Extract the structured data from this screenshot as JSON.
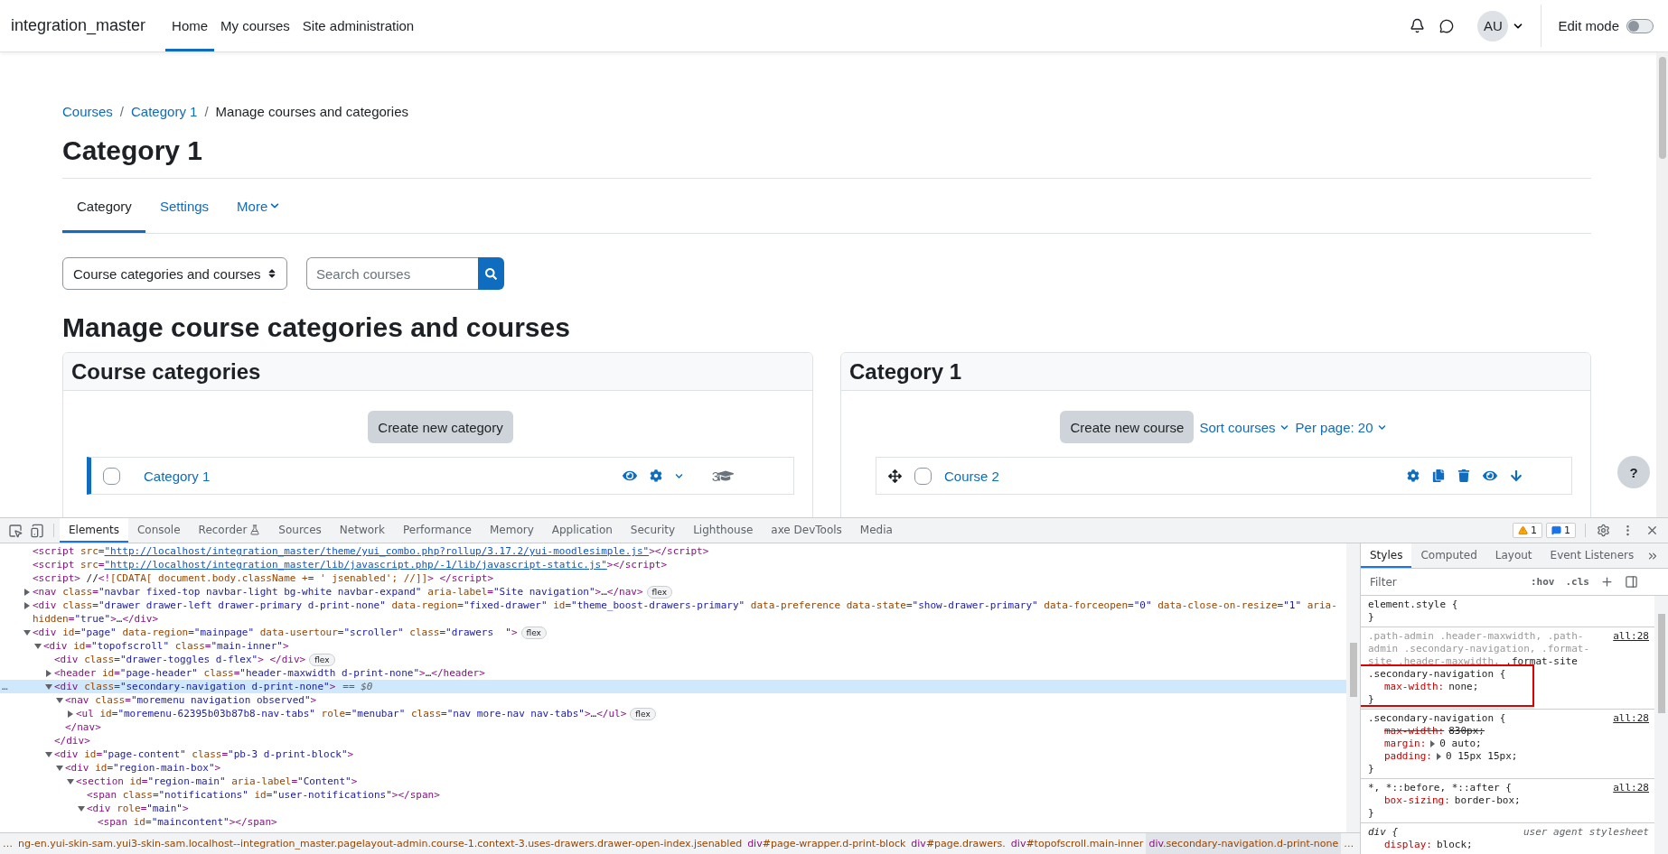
{
  "navbar": {
    "brand": "integration_master",
    "links": [
      {
        "label": "Home",
        "selected": true
      },
      {
        "label": "My courses",
        "selected": false
      },
      {
        "label": "Site administration",
        "selected": false
      }
    ],
    "avatar": "AU",
    "edit_mode": {
      "label": "Edit mode",
      "on": false
    }
  },
  "breadcrumb": [
    {
      "kind": "link",
      "text": "Courses"
    },
    {
      "kind": "separator",
      "text": "/"
    },
    {
      "kind": "link",
      "text": "Category 1"
    },
    {
      "kind": "separator",
      "text": "/"
    },
    {
      "kind": "current",
      "text": "Manage courses and categories"
    }
  ],
  "page_title": "Category 1",
  "tabs": [
    {
      "label": "Category",
      "selected": true,
      "dropdown": false
    },
    {
      "label": "Settings",
      "selected": false,
      "dropdown": false
    },
    {
      "label": "More",
      "selected": false,
      "dropdown": true
    }
  ],
  "view_select": {
    "value": "Course categories and courses"
  },
  "search": {
    "placeholder": "Search courses"
  },
  "heading": "Manage course categories and courses",
  "categories_panel": {
    "title": "Course categories",
    "create_button": "Create new category",
    "rows": [
      {
        "name": "Category 1",
        "checked": false,
        "selected": true,
        "visible": true,
        "count": "3"
      }
    ]
  },
  "courses_panel": {
    "title": "Category 1",
    "create_button": "Create new course",
    "sort": "Sort courses",
    "per_page": "Per page: 20",
    "rows": [
      {
        "name": "Course 2",
        "checked": false,
        "visible": true
      }
    ]
  },
  "help_button": "?",
  "devtools": {
    "tabs": [
      {
        "label": "Elements",
        "selected": true,
        "experimental": false
      },
      {
        "label": "Console",
        "selected": false,
        "experimental": false
      },
      {
        "label": "Recorder",
        "selected": false,
        "experimental": true
      },
      {
        "label": "Sources",
        "selected": false,
        "experimental": false
      },
      {
        "label": "Network",
        "selected": false,
        "experimental": false
      },
      {
        "label": "Performance",
        "selected": false,
        "experimental": false
      },
      {
        "label": "Memory",
        "selected": false,
        "experimental": false
      },
      {
        "label": "Application",
        "selected": false,
        "experimental": false
      },
      {
        "label": "Security",
        "selected": false,
        "experimental": false
      },
      {
        "label": "Lighthouse",
        "selected": false,
        "experimental": false
      },
      {
        "label": "axe DevTools",
        "selected": false,
        "experimental": false
      },
      {
        "label": "Media",
        "selected": false,
        "experimental": false
      }
    ],
    "warnings": "1",
    "messages": "1",
    "tree": [
      {
        "markup": "<script src=\"http://localhost/integration_master/theme/yui_combo.php?rollup/3.17.2/yui-moodlesimple.js\"></script>",
        "selected": false,
        "linked": true
      },
      {
        "markup": "<script src=\"http://localhost/integration_master/lib/javascript.php/-1/lib/javascript-static.js\"></script>",
        "selected": false,
        "linked": true
      },
      {
        "markup": "<script> //<![CDATA[ document.body.className += ' jsenabled'; //]]> </script>",
        "selected": false
      },
      {
        "markup": "<nav class=\"navbar fixed-top navbar-light bg-white navbar-expand\" aria-label=\"Site navigation\">…</nav>",
        "selected": false,
        "expanded": false,
        "badge": "flex"
      },
      {
        "markup": "<div class=\"drawer drawer-left drawer-primary d-print-none\" data-region=\"fixed-drawer\" id=\"theme_boost-drawers-primary\" data-preference data-state=\"show-drawer-primary\" data-forceopen=\"0\" data-close-on-resize=\"1\" aria-hidden=\"true\">…</div>",
        "selected": false,
        "expanded": false
      },
      {
        "markup": "<div id=\"page\" data-region=\"mainpage\" data-usertour=\"scroller\" class=\"drawers  \">",
        "selected": false,
        "expanded": true,
        "badge": "flex",
        "children": [
          {
            "markup": "<div id=\"topofscroll\" class=\"main-inner\">",
            "selected": false,
            "expanded": true,
            "children": [
              {
                "markup": "<div class=\"drawer-toggles d-flex\"> </div>",
                "selected": false,
                "badge": "flex"
              },
              {
                "markup": "<header id=\"page-header\" class=\"header-maxwidth d-print-none\">…</header>",
                "selected": false,
                "expanded": false
              },
              {
                "markup": "<div class=\"secondary-navigation d-print-none\">",
                "selected": true,
                "expanded": true,
                "suffix": "== $0",
                "gutter": "…",
                "closing": "</div>",
                "children": [
                  {
                    "markup": "<nav class=\"moremenu navigation observed\">",
                    "selected": false,
                    "expanded": true,
                    "closing": "</nav>",
                    "children": [
                      {
                        "markup": "<ul id=\"moremenu-62395b03b87b8-nav-tabs\" role=\"menubar\" class=\"nav more-nav nav-tabs\">…</ul>",
                        "selected": false,
                        "expanded": false,
                        "badge": "flex"
                      }
                    ]
                  }
                ]
              },
              {
                "markup": "<div id=\"page-content\" class=\"pb-3 d-print-block\">",
                "selected": false,
                "expanded": true,
                "children": [
                  {
                    "markup": "<div id=\"region-main-box\">",
                    "selected": false,
                    "expanded": true,
                    "children": [
                      {
                        "markup": "<section id=\"region-main\" aria-label=\"Content\">",
                        "selected": false,
                        "expanded": true,
                        "children": [
                          {
                            "markup": "<span class=\"notifications\" id=\"user-notifications\"></span>",
                            "selected": false
                          },
                          {
                            "markup": "<div role=\"main\">",
                            "selected": false,
                            "expanded": true,
                            "children": [
                              {
                                "markup": "<span id=\"maincontent\"></span>",
                                "selected": false
                              }
                            ]
                          }
                        ]
                      }
                    ]
                  }
                ]
              }
            ]
          }
        ]
      }
    ],
    "breadcrumbs": [
      {
        "text": "…",
        "selected": false
      },
      {
        "text": "ng-en.yui-skin-sam.yui3-skin-sam.localhost--integration_master.pagelayout-admin.course-1.context-3.uses-drawers.drawer-open-index.jsenabled",
        "selected": false
      },
      {
        "text": "div#page-wrapper.d-print-block",
        "selected": false
      },
      {
        "text": "div#page.drawers.",
        "selected": false
      },
      {
        "text": "div#topofscroll.main-inner",
        "selected": false
      },
      {
        "text": "div.secondary-navigation.d-print-none",
        "selected": true
      },
      {
        "text": "…",
        "selected": false
      }
    ],
    "styles": {
      "tabs": [
        {
          "label": "Styles",
          "selected": true
        },
        {
          "label": "Computed",
          "selected": false
        },
        {
          "label": "Layout",
          "selected": false
        },
        {
          "label": "Event Listeners",
          "selected": false
        }
      ],
      "filter_placeholder": "Filter",
      "hov": ":hov",
      "cls": ".cls",
      "rules": [
        {
          "selector": [
            {
              "text": "element.style {",
              "matched": true
            }
          ],
          "user_agent": false,
          "highlighted": false,
          "close": "}"
        },
        {
          "selector": [
            {
              "text": ".path-admin .header-maxwidth, .path-admin .secondary-navigation, .format-site .header-maxwidth, ",
              "matched": false
            },
            {
              "text": ".format-site .secondary-navigation {",
              "matched": true
            }
          ],
          "source": "all:28",
          "user_agent": false,
          "highlighted": true,
          "declarations": [
            {
              "property": "max-width:",
              "value": "none;",
              "overridden": false,
              "expandable": false
            }
          ],
          "close": "}"
        },
        {
          "selector": [
            {
              "text": ".secondary-navigation {",
              "matched": true
            }
          ],
          "source": "all:28",
          "user_agent": false,
          "highlighted": false,
          "declarations": [
            {
              "property": "max-width:",
              "value": "830px;",
              "overridden": true,
              "expandable": false
            },
            {
              "property": "margin:",
              "value": "0 auto;",
              "overridden": false,
              "expandable": true
            },
            {
              "property": "padding:",
              "value": "0 15px 15px;",
              "overridden": false,
              "expandable": true
            }
          ],
          "close": "}"
        },
        {
          "selector": [
            {
              "text": "*, *::before, *::after {",
              "matched": true
            }
          ],
          "source": "all:28",
          "user_agent": false,
          "highlighted": false,
          "declarations": [
            {
              "property": "box-sizing:",
              "value": "border-box;",
              "overridden": false,
              "expandable": false
            }
          ],
          "close": "}"
        },
        {
          "selector": [
            {
              "text": "div {",
              "matched": true
            }
          ],
          "source": "user agent stylesheet",
          "user_agent": true,
          "highlighted": false,
          "declarations": [
            {
              "property": "display:",
              "value": "block;",
              "overridden": false,
              "expandable": false
            }
          ]
        }
      ]
    }
  }
}
